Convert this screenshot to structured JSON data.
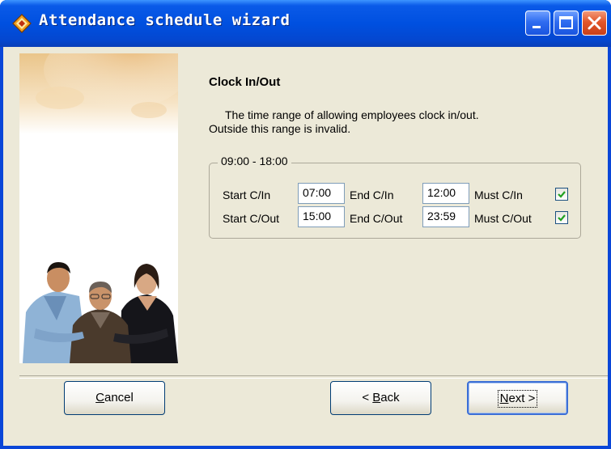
{
  "window": {
    "title": "Attendance schedule wizard",
    "buttons": {
      "minimize": "minimize-icon",
      "maximize": "maximize-icon",
      "close": "close-icon"
    }
  },
  "page": {
    "heading": "Clock In/Out",
    "description_line1": "The time range of allowing employees clock in/out.",
    "description_line2": "Outside this range is invalid."
  },
  "range_group": {
    "legend": "09:00 - 18:00",
    "start_in_label": "Start C/In",
    "start_in_value": "07:00",
    "end_in_label": "End C/In",
    "end_in_value": "12:00",
    "must_in_label": "Must C/In",
    "must_in_checked": true,
    "start_out_label": "Start C/Out",
    "start_out_value": "15:00",
    "end_out_label": "End C/Out",
    "end_out_value": "23:59",
    "must_out_label": "Must C/Out",
    "must_out_checked": true
  },
  "footer": {
    "cancel_prefix": "",
    "cancel_mnemonic": "C",
    "cancel_rest": "ancel",
    "back_prefix": "< ",
    "back_mnemonic": "B",
    "back_rest": "ack",
    "next_prefix": "",
    "next_mnemonic": "N",
    "next_rest": "ext >"
  },
  "colors": {
    "titlebar": "#0054e3",
    "dialog_bg": "#ece9d8",
    "checkmark": "#21a121"
  }
}
